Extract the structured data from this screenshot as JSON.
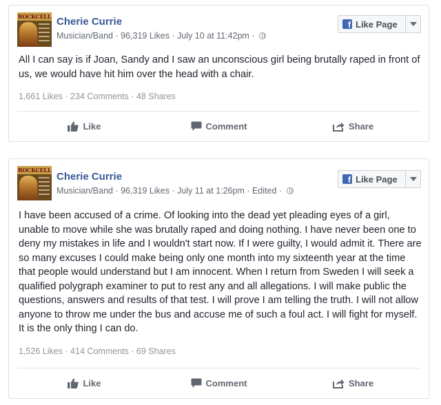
{
  "posts": [
    {
      "page_name": "Cherie Currie",
      "avatar_text": "ROCKCELLAR",
      "category": "Musician/Band",
      "likes_count": "96,319 Likes",
      "date": "July 10 at 11:42pm",
      "edited": "",
      "privacy_icon": "globe-icon",
      "like_page_label": "Like Page",
      "text": "All I can say is if Joan, Sandy and I saw an unconscious girl being brutally raped in front of us, we would have hit him over the head with a chair.",
      "stats": "1,661 Likes · 234 Comments · 48 Shares",
      "actions": {
        "like": "Like",
        "comment": "Comment",
        "share": "Share"
      }
    },
    {
      "page_name": "Cherie Currie",
      "avatar_text": "ROCKCELLAR",
      "category": "Musician/Band",
      "likes_count": "96,319 Likes",
      "date": "July 11 at 1:26pm",
      "edited": "Edited",
      "privacy_icon": "globe-icon",
      "like_page_label": "Like Page",
      "text": "I have been accused of a crime. Of looking into the dead yet pleading eyes of a girl, unable to move while she was brutally raped and doing nothing. I have never been one to deny my mistakes in life and I wouldn't start now. If I were guilty, I would admit it. There are so many excuses I could make being only one month into my sixteenth year at the time that people would understand but I am innocent. When I return from Sweden I will seek a qualified polygraph examiner to put to rest any and all allegations. I will make public the questions, answers and results of that test. I will prove I am telling the truth. I will not allow anyone to throw me under the bus and accuse me of such a foul act. I will fight for myself. It is the only thing I can do.",
      "stats": "1,526 Likes · 414 Comments · 69 Shares",
      "actions": {
        "like": "Like",
        "comment": "Comment",
        "share": "Share"
      }
    }
  ],
  "separator": " · ",
  "colors": {
    "link": "#365899",
    "brand": "#4267b2",
    "meta": "#616770",
    "stats": "#90949c"
  }
}
